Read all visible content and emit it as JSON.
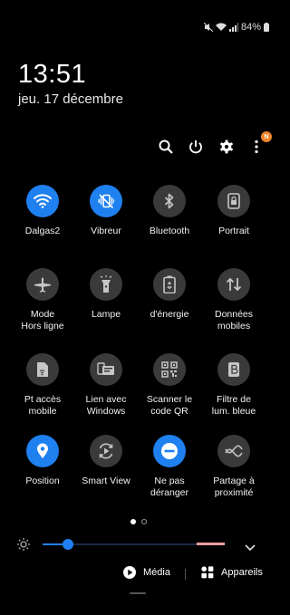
{
  "status_bar": {
    "battery": "84%"
  },
  "clock": {
    "time": "13:51",
    "date": "jeu. 17 décembre"
  },
  "header_actions": {
    "notification_badge": "N"
  },
  "tiles": [
    {
      "label": "Dalgas2",
      "icon": "wifi-icon",
      "active": true
    },
    {
      "label": "Vibreur",
      "icon": "vibrate-icon",
      "active": true
    },
    {
      "label": "Bluetooth",
      "icon": "bluetooth-icon",
      "active": false
    },
    {
      "label": "Portrait",
      "icon": "portrait-lock-icon",
      "active": false
    },
    {
      "label": "Mode\nHors ligne",
      "icon": "airplane-icon",
      "active": false
    },
    {
      "label": "Lampe",
      "icon": "flashlight-icon",
      "active": false
    },
    {
      "label": "d'énergie",
      "icon": "battery-saver-icon",
      "active": false
    },
    {
      "label": "Données\nmobiles",
      "icon": "mobile-data-icon",
      "active": false
    },
    {
      "label": "Pt accès\nmobile",
      "icon": "hotspot-icon",
      "active": false
    },
    {
      "label": "Lien avec\nWindows",
      "icon": "link-windows-icon",
      "active": false
    },
    {
      "label": "Scanner le\ncode QR",
      "icon": "qr-icon",
      "active": false
    },
    {
      "label": "Filtre de\nlum. bleue",
      "icon": "blue-light-icon",
      "active": false
    },
    {
      "label": "Position",
      "icon": "location-icon",
      "active": true
    },
    {
      "label": "Smart View",
      "icon": "smart-view-icon",
      "active": false
    },
    {
      "label": "Ne pas\ndéranger",
      "icon": "dnd-icon",
      "active": true
    },
    {
      "label": "Partage à\nproximité",
      "icon": "nearby-share-icon",
      "active": false
    }
  ],
  "pager": {
    "pages": 2,
    "current": 1
  },
  "brightness": {
    "level": 0.14
  },
  "bottom": {
    "media_label": "Média",
    "devices_label": "Appareils"
  },
  "colors": {
    "accent": "#1f80f0",
    "tile_off": "#3a3a3a",
    "badge": "#f0832a"
  }
}
